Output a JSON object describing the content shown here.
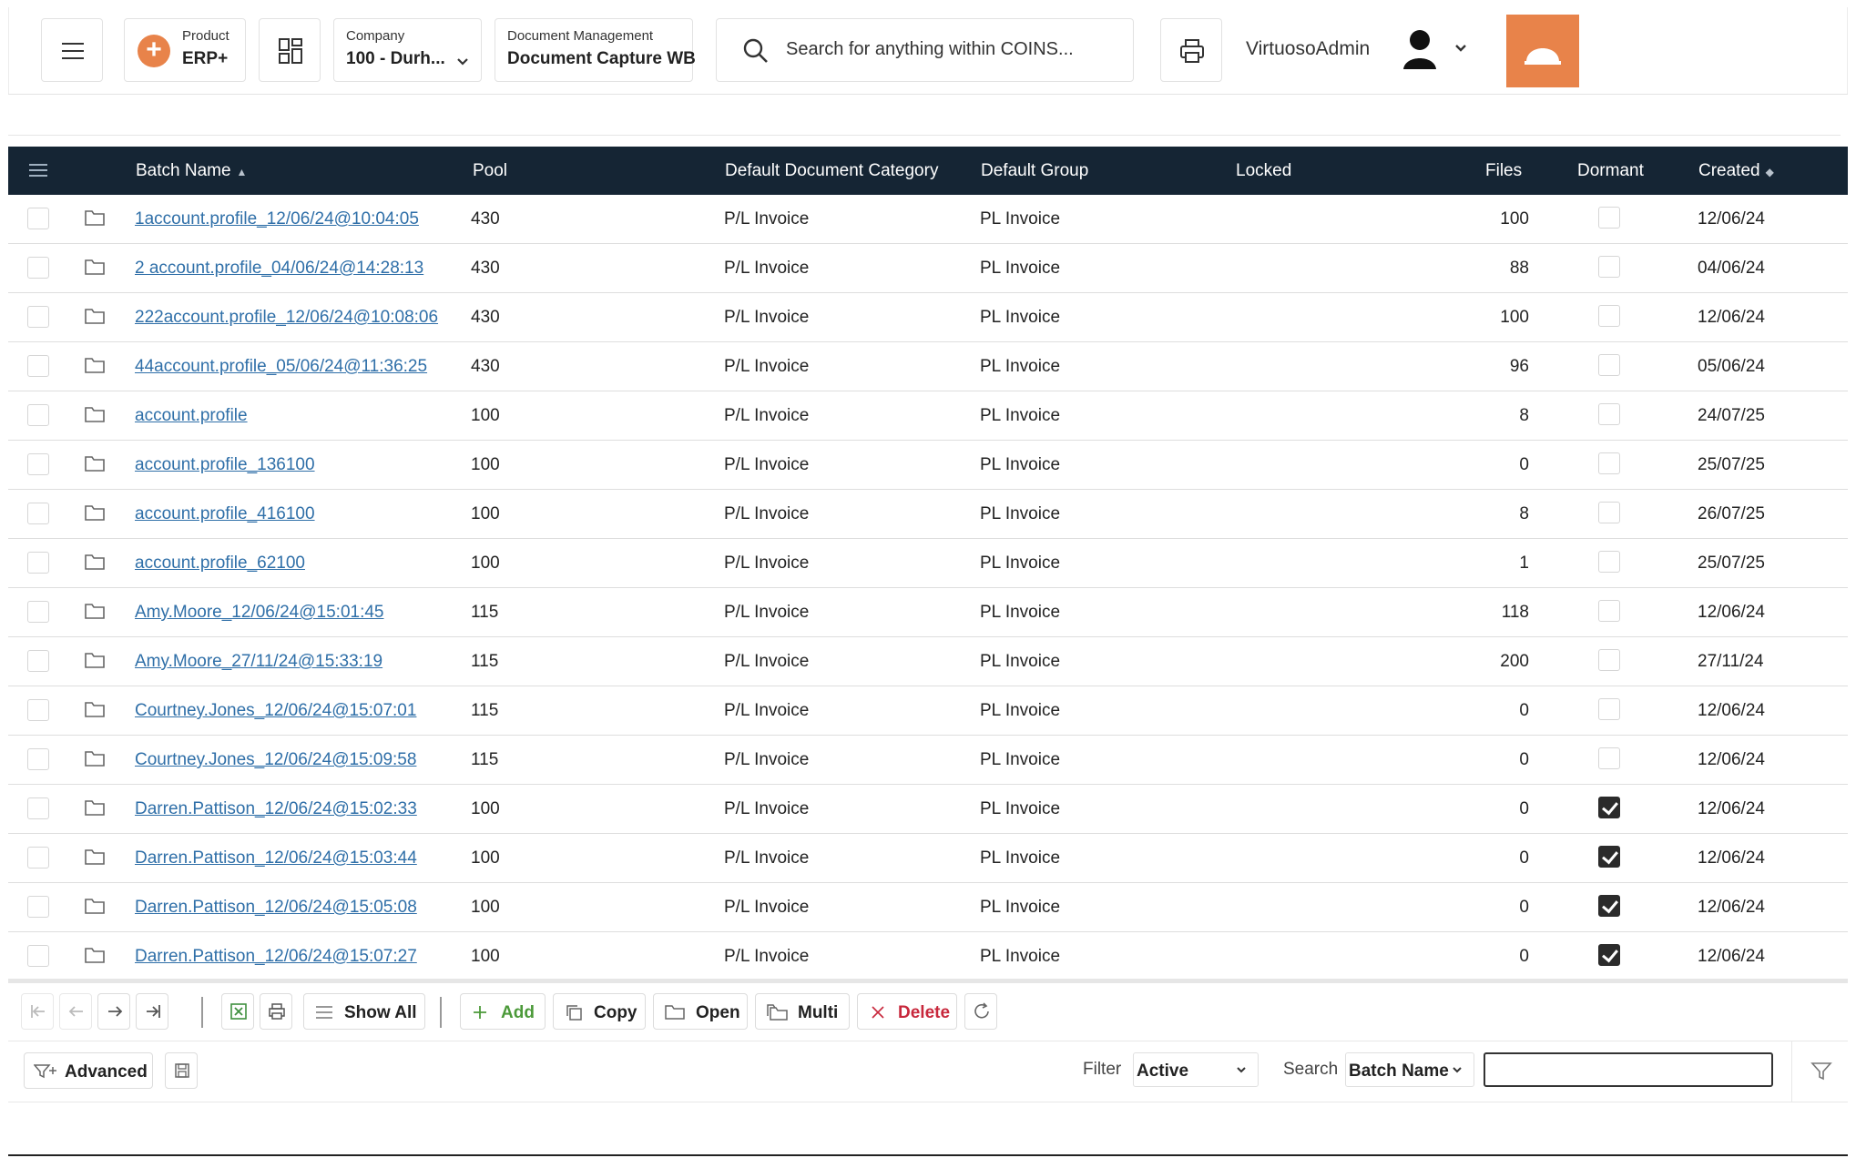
{
  "header": {
    "product_label": "Product",
    "product_value": "ERP+",
    "company_label": "Company",
    "company_value": "100 - Durh...",
    "module_label": "Document Management",
    "module_value": "Document Capture WB",
    "search_placeholder": "Search for anything within COINS...",
    "user_name": "VirtuosoAdmin",
    "accent_color": "#e8834a"
  },
  "table": {
    "columns": {
      "batch_name": "Batch Name",
      "pool": "Pool",
      "default_category": "Default Document Category",
      "default_group": "Default Group",
      "locked": "Locked",
      "files": "Files",
      "dormant": "Dormant",
      "created": "Created"
    },
    "rows": [
      {
        "batch_name": "1account.profile_12/06/24@10:04:05",
        "pool": "430",
        "category": "P/L Invoice",
        "group": "PL Invoice",
        "files": "100",
        "dormant": false,
        "created": "12/06/24"
      },
      {
        "batch_name": "2 account.profile_04/06/24@14:28:13",
        "pool": "430",
        "category": "P/L Invoice",
        "group": "PL Invoice",
        "files": "88",
        "dormant": false,
        "created": "04/06/24"
      },
      {
        "batch_name": "222account.profile_12/06/24@10:08:06",
        "pool": "430",
        "category": "P/L Invoice",
        "group": "PL Invoice",
        "files": "100",
        "dormant": false,
        "created": "12/06/24"
      },
      {
        "batch_name": "44account.profile_05/06/24@11:36:25",
        "pool": "430",
        "category": "P/L Invoice",
        "group": "PL Invoice",
        "files": "96",
        "dormant": false,
        "created": "05/06/24"
      },
      {
        "batch_name": "account.profile",
        "pool": "100",
        "category": "P/L Invoice",
        "group": "PL Invoice",
        "files": "8",
        "dormant": false,
        "created": "24/07/25"
      },
      {
        "batch_name": "account.profile_136100",
        "pool": "100",
        "category": "P/L Invoice",
        "group": "PL Invoice",
        "files": "0",
        "dormant": false,
        "created": "25/07/25"
      },
      {
        "batch_name": "account.profile_416100",
        "pool": "100",
        "category": "P/L Invoice",
        "group": "PL Invoice",
        "files": "8",
        "dormant": false,
        "created": "26/07/25"
      },
      {
        "batch_name": "account.profile_62100",
        "pool": "100",
        "category": "P/L Invoice",
        "group": "PL Invoice",
        "files": "1",
        "dormant": false,
        "created": "25/07/25"
      },
      {
        "batch_name": "Amy.Moore_12/06/24@15:01:45",
        "pool": "115",
        "category": "P/L Invoice",
        "group": "PL Invoice",
        "files": "118",
        "dormant": false,
        "created": "12/06/24"
      },
      {
        "batch_name": "Amy.Moore_27/11/24@15:33:19",
        "pool": "115",
        "category": "P/L Invoice",
        "group": "PL Invoice",
        "files": "200",
        "dormant": false,
        "created": "27/11/24"
      },
      {
        "batch_name": "Courtney.Jones_12/06/24@15:07:01",
        "pool": "115",
        "category": "P/L Invoice",
        "group": "PL Invoice",
        "files": "0",
        "dormant": false,
        "created": "12/06/24"
      },
      {
        "batch_name": "Courtney.Jones_12/06/24@15:09:58",
        "pool": "115",
        "category": "P/L Invoice",
        "group": "PL Invoice",
        "files": "0",
        "dormant": false,
        "created": "12/06/24"
      },
      {
        "batch_name": "Darren.Pattison_12/06/24@15:02:33",
        "pool": "100",
        "category": "P/L Invoice",
        "group": "PL Invoice",
        "files": "0",
        "dormant": true,
        "created": "12/06/24"
      },
      {
        "batch_name": "Darren.Pattison_12/06/24@15:03:44",
        "pool": "100",
        "category": "P/L Invoice",
        "group": "PL Invoice",
        "files": "0",
        "dormant": true,
        "created": "12/06/24"
      },
      {
        "batch_name": "Darren.Pattison_12/06/24@15:05:08",
        "pool": "100",
        "category": "P/L Invoice",
        "group": "PL Invoice",
        "files": "0",
        "dormant": true,
        "created": "12/06/24"
      },
      {
        "batch_name": "Darren.Pattison_12/06/24@15:07:27",
        "pool": "100",
        "category": "P/L Invoice",
        "group": "PL Invoice",
        "files": "0",
        "dormant": true,
        "created": "12/06/24"
      }
    ]
  },
  "toolbar": {
    "show_all": "Show All",
    "add": "Add",
    "copy": "Copy",
    "open": "Open",
    "multi": "Multi",
    "delete": "Delete",
    "add_color": "#4c9a3a",
    "delete_color": "#c8283c"
  },
  "footer": {
    "advanced": "Advanced",
    "filter_label": "Filter",
    "filter_value": "Active",
    "search_label": "Search",
    "search_field": "Batch Name",
    "search_value": ""
  }
}
